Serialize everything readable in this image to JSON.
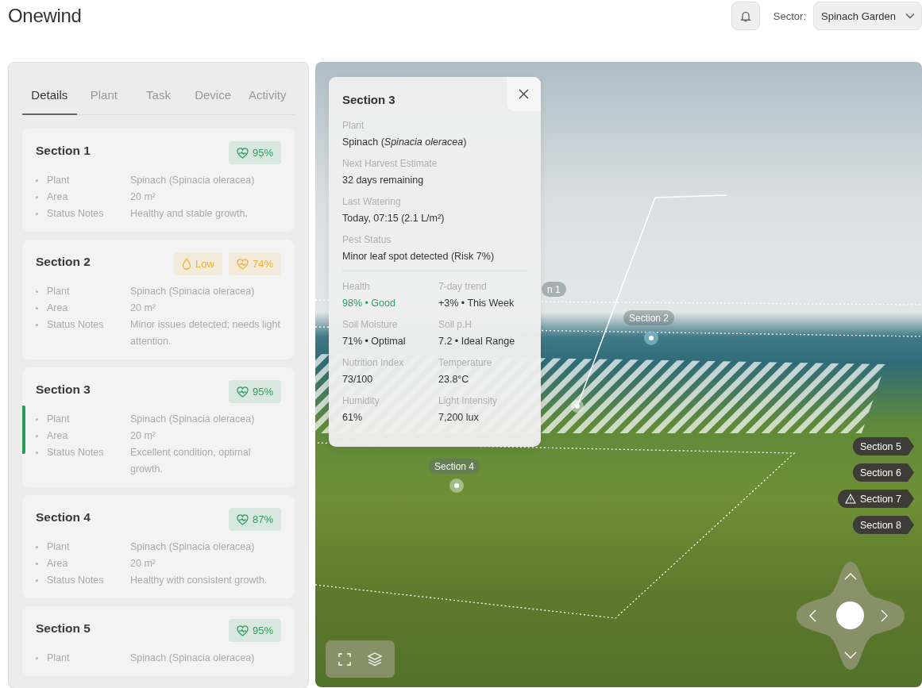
{
  "app": {
    "title": "Onewind"
  },
  "header": {
    "sector_label": "Sector:",
    "sector_value": "Spinach Garden"
  },
  "tabs": [
    {
      "label": "Details",
      "selected": true
    },
    {
      "label": "Plant",
      "selected": false
    },
    {
      "label": "Task",
      "selected": false
    },
    {
      "label": "Device",
      "selected": false
    },
    {
      "label": "Activity",
      "selected": false
    }
  ],
  "sections": [
    {
      "title": "Section 1",
      "selected": false,
      "badges": [
        {
          "kind": "health",
          "color": "#2f9e5e",
          "text": "95%"
        }
      ],
      "rows": [
        {
          "label": "Plant",
          "value": "Spinach (Spinacia oleracea)"
        },
        {
          "label": "Area",
          "value": "20 m²"
        },
        {
          "label": "Status Notes",
          "value": "Healthy and stable growth."
        }
      ]
    },
    {
      "title": "Section 2",
      "selected": false,
      "badges": [
        {
          "kind": "water",
          "color": "#f0b23a",
          "text": "Low"
        },
        {
          "kind": "health",
          "color": "#f0b23a",
          "text": "74%"
        }
      ],
      "rows": [
        {
          "label": "Plant",
          "value": "Spinach (Spinacia oleracea)"
        },
        {
          "label": "Area",
          "value": "20 m²"
        },
        {
          "label": "Status Notes",
          "value": "Minor issues detected; needs light attention."
        }
      ]
    },
    {
      "title": "Section 3",
      "selected": true,
      "badges": [
        {
          "kind": "health",
          "color": "#2f9e5e",
          "text": "95%"
        }
      ],
      "rows": [
        {
          "label": "Plant",
          "value": "Spinach (Spinacia oleracea)"
        },
        {
          "label": "Area",
          "value": "20 m²"
        },
        {
          "label": "Status Notes",
          "value": "Excellent condition, optimal growth."
        }
      ]
    },
    {
      "title": "Section 4",
      "selected": false,
      "badges": [
        {
          "kind": "health",
          "color": "#2f9e5e",
          "text": "87%"
        }
      ],
      "rows": [
        {
          "label": "Plant",
          "value": "Spinach (Spinacia oleracea)"
        },
        {
          "label": "Area",
          "value": "20 m²"
        },
        {
          "label": "Status Notes",
          "value": "Healthy with consistent growth."
        }
      ]
    },
    {
      "title": "Section 5",
      "selected": false,
      "badges": [
        {
          "kind": "health",
          "color": "#2f9e5e",
          "text": "95%"
        }
      ],
      "rows": [
        {
          "label": "Plant",
          "value": "Spinach (Spinacia oleracea)"
        }
      ]
    }
  ],
  "popup": {
    "title": "Section 3",
    "fields": [
      {
        "label": "Plant",
        "value": "Spinach (*Spinacia oleracea*)"
      },
      {
        "label": "Next Harvest Estimate",
        "value": "32 days remaining"
      },
      {
        "label": "Last Watering",
        "value": "Today, 07:15 (2.1 L/m²)"
      },
      {
        "label": "Pest Status",
        "value": "Minor leaf spot detected (Risk 7%)"
      }
    ],
    "metrics": [
      {
        "label": "Health",
        "value": "98% • Good",
        "color": "#2f9e5e"
      },
      {
        "label": "7-day trend",
        "value": "+3% • This Week",
        "color": "#333333"
      },
      {
        "label": "Soil Moisture",
        "value": "71% • Optimal",
        "color": "#333333"
      },
      {
        "label": "Soil p.H",
        "value": "7.2 • Ideal Range",
        "color": "#333333"
      },
      {
        "label": "Nutrition Index",
        "value": "73/100",
        "color": "#333333"
      },
      {
        "label": "Temperature",
        "value": "23.8°C",
        "color": "#333333"
      },
      {
        "label": "Humidity",
        "value": "61%",
        "color": "#333333"
      },
      {
        "label": "Light Intensity",
        "value": "7,200 lux",
        "color": "#333333"
      }
    ]
  },
  "map": {
    "zone_labels": [
      {
        "text": "n 1"
      },
      {
        "text": "Section 2"
      },
      {
        "text": "Section 4"
      }
    ],
    "section_tags": [
      {
        "text": "Section 5",
        "kind": "plain"
      },
      {
        "text": "Section 6",
        "kind": "plain"
      },
      {
        "text": "Section 7",
        "kind": "warning"
      },
      {
        "text": "Section 8",
        "kind": "plain"
      }
    ]
  }
}
